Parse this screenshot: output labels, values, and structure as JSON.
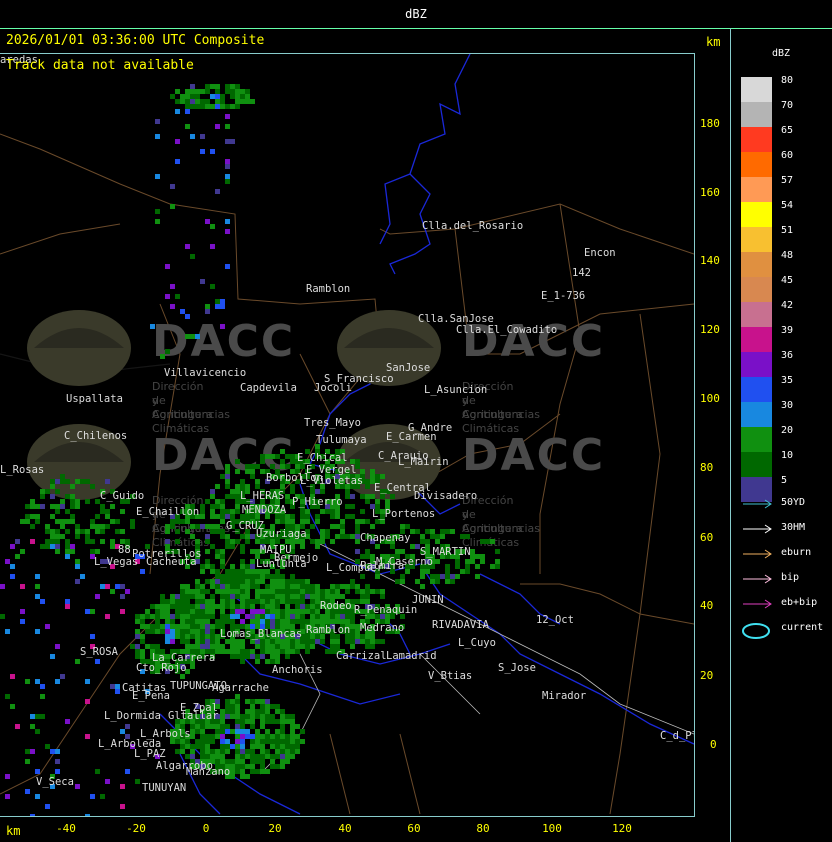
{
  "window_title": "dBZ",
  "header": "2026/01/01 03:36:00 UTC Composite",
  "track_message": "Track data not available",
  "axis_unit": "km",
  "y_ticks": [
    "180",
    "160",
    "140",
    "120",
    "100",
    "80",
    "60",
    "40",
    "20",
    "0"
  ],
  "x_ticks": [
    "-40",
    "-20",
    "0",
    "20",
    "40",
    "60",
    "80",
    "100",
    "120"
  ],
  "legend": {
    "title": "dBZ",
    "levels": [
      {
        "label": "80",
        "color": "#d8d8d8"
      },
      {
        "label": "70",
        "color": "#b4b4b4"
      },
      {
        "label": "65",
        "color": "#ff3a20"
      },
      {
        "label": "60",
        "color": "#ff6a00"
      },
      {
        "label": "57",
        "color": "#ff9a55"
      },
      {
        "label": "54",
        "color": "#ffff00"
      },
      {
        "label": "51",
        "color": "#f8c030"
      },
      {
        "label": "48",
        "color": "#e09040"
      },
      {
        "label": "45",
        "color": "#d88850"
      },
      {
        "label": "42",
        "color": "#c87090"
      },
      {
        "label": "39",
        "color": "#c8128c"
      },
      {
        "label": "36",
        "color": "#7a10c8"
      },
      {
        "label": "35",
        "color": "#2050f0"
      },
      {
        "label": "30",
        "color": "#1888e0"
      },
      {
        "label": "20",
        "color": "#109010"
      },
      {
        "label": "10",
        "color": "#006800"
      },
      {
        "label": "5",
        "color": "#403890"
      }
    ],
    "tracks": [
      {
        "label": "50YD",
        "color": "#40c0d0"
      },
      {
        "label": "30HM",
        "color": "#ffffff"
      },
      {
        "label": "eburn",
        "color": "#f0b060"
      },
      {
        "label": "bip",
        "color": "#ffc0e0"
      },
      {
        "label": "eb+bip",
        "color": "#e040c0"
      },
      {
        "label": "current",
        "color": "#40e0f0"
      }
    ]
  },
  "watermark": {
    "name": "DACC",
    "line1": "Dirección de Agricultura",
    "line2": "y Contingencias Climáticas"
  },
  "places": [
    "Clla.del_Rosario",
    "Encon",
    "142",
    "E_1-736",
    "Ramblon",
    "Clla.SanJose",
    "Clla.El_Cowadito",
    "Villavicencio",
    "Capdevila",
    "S_Francisco",
    "SanJose",
    "L_Asuncion",
    "Uspallata",
    "Jocoli",
    "Tres_Mayo",
    "Tulumaya",
    "G_Andre",
    "E_Carmen",
    "C_Chilenos",
    "E_Chical",
    "C_Arauio",
    "L_Mairin",
    "E_Vergel",
    "Borbollon",
    "L_Violetas",
    "E_Central",
    "Divisadero",
    "C_Guido",
    "L_HERAS",
    "P_Hierro",
    "MENDOZA",
    "E_Chaillon",
    "G_CRUZ",
    "Uzuriaga",
    "L_Portenos",
    "Chapenay",
    "88",
    "Potrerillos",
    "L_Vegas",
    "Cacheuta",
    "MAIPU",
    "Lunlunta",
    "Bermejo",
    "Palmira",
    "S_MARTIN",
    "M_Caserno",
    "L_Compuer",
    "Rodeo",
    "R_Penaquin",
    "JUNIN",
    "Ramblon",
    "Medrano",
    "RIVADAVIA",
    "12_Oct",
    "Lomas_Blancas",
    "Agarrache",
    "Anchoris",
    "Carrizal",
    "Lamadrid",
    "L_Cuyo",
    "S_ROSA",
    "La_Carrera",
    "Cto_Rojo",
    "S_Jose",
    "Catitas",
    "E_Pena",
    "TUPUNGATO",
    "V_Btias",
    "Mirador",
    "L_Dormida",
    "Gltallar",
    "E_Zpal",
    "L_Arboleda",
    "L_Arbols",
    "C_d_Plata",
    "L_PAZ",
    "Algarrobo",
    "V_Seca",
    "Manzano",
    "TUNUYAN",
    "L_Rosas",
    "aredas"
  ]
}
